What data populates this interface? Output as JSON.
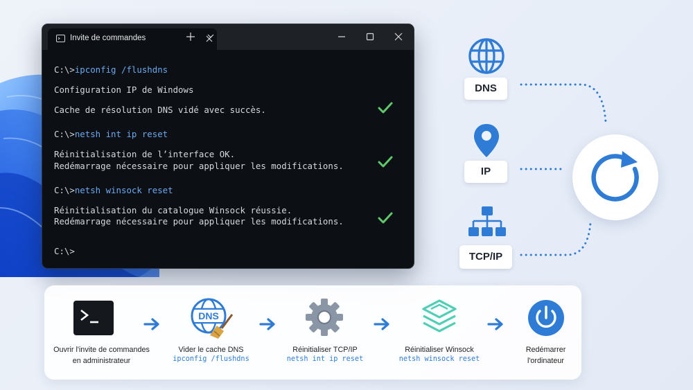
{
  "terminal": {
    "tab_title": "Invite de commandes",
    "lines": [
      {
        "prompt": "C:\\>",
        "command": "ipconfig /flushdns"
      },
      {
        "text": "Configuration IP de Windows"
      },
      {
        "text": "Cache de résolution DNS vidé avec succès."
      },
      {
        "prompt": "C:\\>",
        "command": "netsh int ip reset"
      },
      {
        "text": "Réinitialisation de l’interface OK."
      },
      {
        "text": "Redémarrage nécessaire pour appliquer les modifications."
      },
      {
        "prompt": "C:\\>",
        "command": "netsh winsock reset"
      },
      {
        "text": "Réinitialisation du catalogue Winsock réussie."
      },
      {
        "text": "Redémarrage nécessaire pour appliquer les modifications."
      },
      {
        "prompt": "C:\\>"
      }
    ]
  },
  "services": [
    {
      "label": "DNS",
      "icon": "globe-icon"
    },
    {
      "label": "IP",
      "icon": "location-pin-icon"
    },
    {
      "label": "TCP/IP",
      "icon": "network-hierarchy-icon"
    }
  ],
  "refresh_icon": "refresh-icon",
  "steps": [
    {
      "title_1": "Ouvrir l'invite de commandes",
      "title_2": "en administrateur",
      "command": "",
      "icon": "terminal-icon"
    },
    {
      "title_1": "Vider le cache DNS",
      "title_2": "",
      "command": "ipconfig /flushdns",
      "icon": "dns-broom-icon",
      "icon_text": "DNS"
    },
    {
      "title_1": "Réinitialiser TCP/IP",
      "title_2": "",
      "command": "netsh int ip reset",
      "icon": "gear-icon"
    },
    {
      "title_1": "Réinitialiser Winsock",
      "title_2": "",
      "command": "netsh winsock reset",
      "icon": "layers-icon"
    },
    {
      "title_1": "Redémarrer",
      "title_2": "l'ordinateur",
      "command": "",
      "icon": "power-icon"
    }
  ],
  "colors": {
    "accent": "#2e7cd6",
    "check": "#5fc86a",
    "terminal_bg": "#0c0f14"
  }
}
